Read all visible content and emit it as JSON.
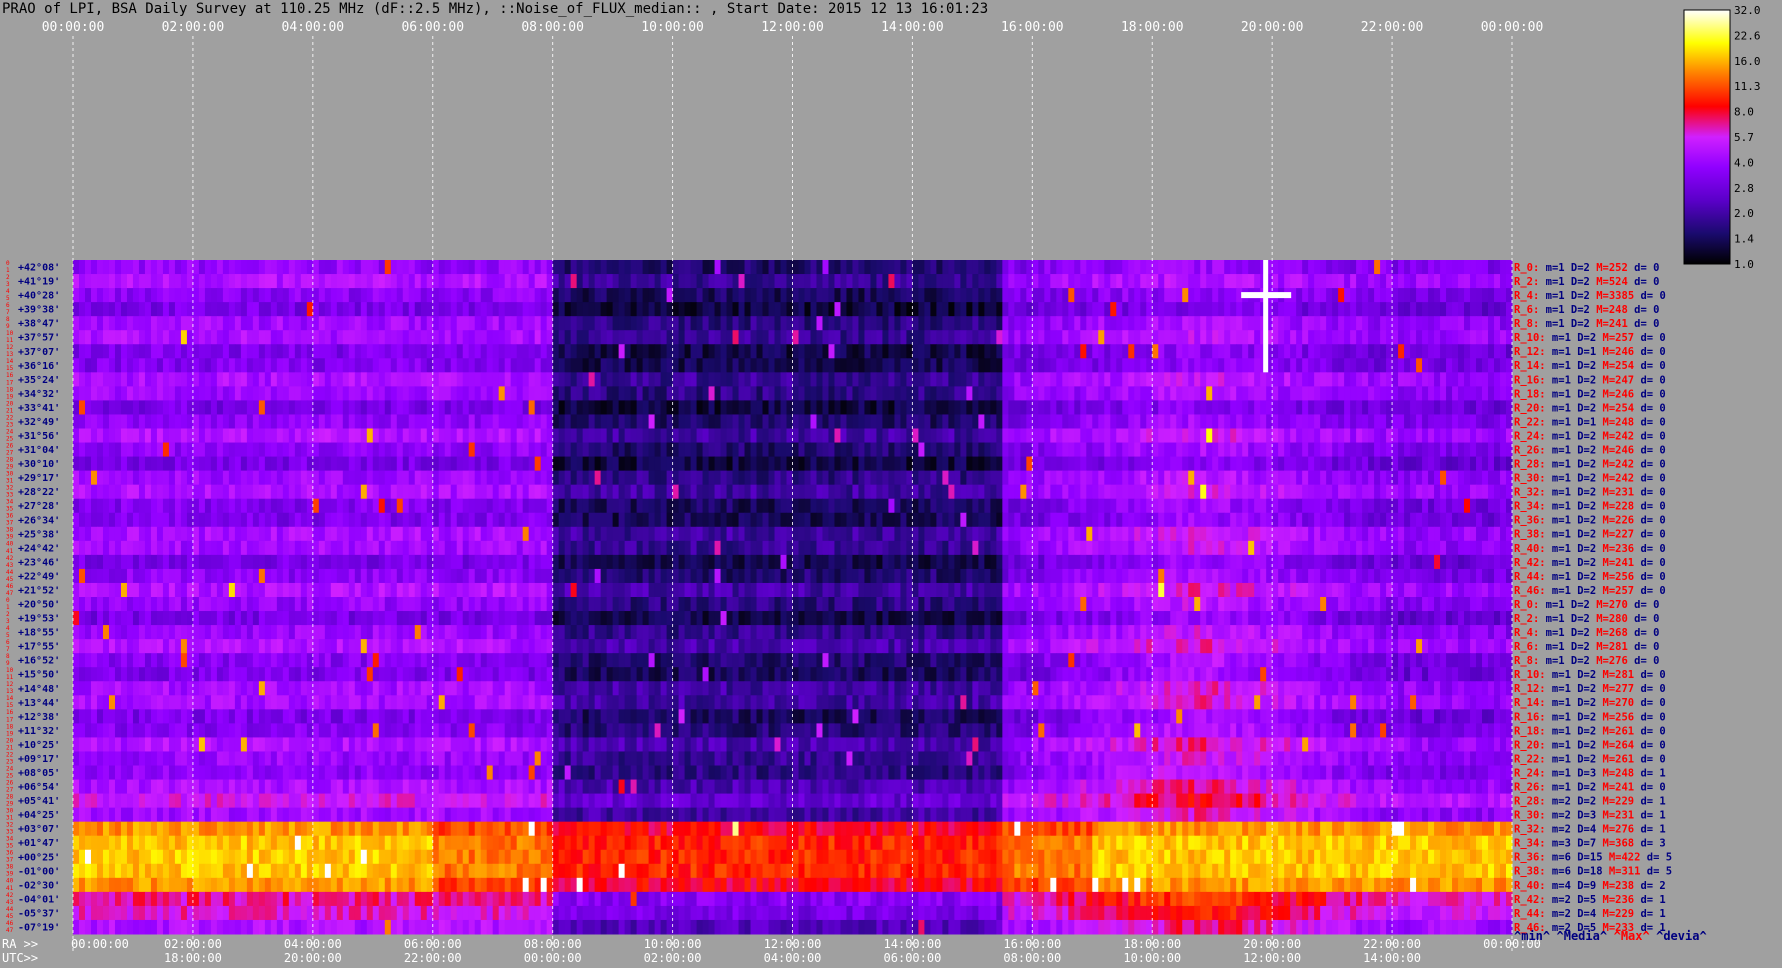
{
  "title": "PRAO of LPI, BSA Daily Survey at 110.25 MHz (dF::2.5 MHz), ::Noise_of_FLUX_median:: , Start Date: 2015 12 13 16:01:23",
  "colors": {
    "background": "#a0a0a0",
    "label_red": "#ff0000",
    "label_navy": "#000080",
    "label_blue": "#0000c0"
  },
  "chart_data": {
    "type": "heatmap",
    "title": "PRAO of LPI, BSA Daily Survey at 110.25 MHz (dF::2.5 MHz), ::Noise_of_FLUX_median:: , Start Date: 2015 12 13 16:01:23",
    "x_ra_ticks": [
      "00:00:00",
      "02:00:00",
      "04:00:00",
      "06:00:00",
      "08:00:00",
      "10:00:00",
      "12:00:00",
      "14:00:00",
      "16:00:00",
      "18:00:00",
      "20:00:00",
      "22:00:00",
      "00:00:00"
    ],
    "x_utc_ticks": [
      "18:00:00",
      "20:00:00",
      "22:00:00",
      "00:00:00",
      "02:00:00",
      "04:00:00",
      "06:00:00",
      "08:00:00",
      "10:00:00",
      "12:00:00",
      "14:00:00"
    ],
    "x_axis_prefix_ra": "RA >>",
    "x_axis_prefix_utc": "UTC>>",
    "bottom_first_tick": "00:00:00",
    "y_declinations": [
      "+42°08'",
      "+41°19'",
      "+40°28'",
      "+39°38'",
      "+38°47'",
      "+37°57'",
      "+37°07'",
      "+36°16'",
      "+35°24'",
      "+34°32'",
      "+33°41'",
      "+32°49'",
      "+31°56'",
      "+31°04'",
      "+30°10'",
      "+29°17'",
      "+28°22'",
      "+27°28'",
      "+26°34'",
      "+25°38'",
      "+24°42'",
      "+23°46'",
      "+22°49'",
      "+21°52'",
      "+20°50'",
      "+19°53'",
      "+18°55'",
      "+17°55'",
      "+16°52'",
      "+15°50'",
      "+14°48'",
      "+13°44'",
      "+12°38'",
      "+11°32'",
      "+10°25'",
      "+09°17'",
      "+08°05'",
      "+06°54'",
      "+05°41'",
      "+04°25'",
      "+03°07'",
      "+01°47'",
      "+00°25'",
      "-01°00'",
      "-02°30'",
      "-04°01'",
      "-05°37'",
      "-07°19'"
    ],
    "row_numbers": [
      "0",
      "1",
      "2",
      "3",
      "4",
      "5",
      "6",
      "7",
      "8",
      "9",
      "10",
      "11",
      "12",
      "13",
      "14",
      "15",
      "16",
      "17",
      "18",
      "19",
      "20",
      "21",
      "22",
      "23",
      "24",
      "25",
      "26",
      "27",
      "28",
      "29",
      "30",
      "31",
      "32",
      "33",
      "34",
      "35",
      "36",
      "37",
      "38",
      "39",
      "40",
      "41",
      "42",
      "43",
      "44",
      "45",
      "46",
      "47",
      "0",
      "1",
      "2",
      "3",
      "4",
      "5",
      "6",
      "7",
      "8",
      "9",
      "10",
      "11",
      "12",
      "13",
      "14",
      "15",
      "16",
      "17",
      "18",
      "19",
      "20",
      "21",
      "22",
      "23",
      "24",
      "25",
      "26",
      "27",
      "28",
      "29",
      "30",
      "31",
      "32",
      "33",
      "34",
      "35",
      "36",
      "37",
      "38",
      "39",
      "40",
      "41",
      "42",
      "43",
      "44",
      "45",
      "46",
      "47"
    ],
    "row_stats": [
      {
        "r": "R_0:",
        "m": "m=1",
        "d": "D=2",
        "M": "M=252",
        "dv": "d= 0"
      },
      {
        "r": "R_2:",
        "m": "m=1",
        "d": "D=2",
        "M": "M=524",
        "dv": "d= 0"
      },
      {
        "r": "R_4:",
        "m": "m=1",
        "d": "D=2",
        "M": "M=3385",
        "dv": "d= 0"
      },
      {
        "r": "R_6:",
        "m": "m=1",
        "d": "D=2",
        "M": "M=248",
        "dv": "d= 0"
      },
      {
        "r": "R_8:",
        "m": "m=1",
        "d": "D=2",
        "M": "M=241",
        "dv": "d= 0"
      },
      {
        "r": "R_10:",
        "m": "m=1",
        "d": "D=2",
        "M": "M=257",
        "dv": "d= 0"
      },
      {
        "r": "R_12:",
        "m": "m=1",
        "d": "D=1",
        "M": "M=246",
        "dv": "d= 0"
      },
      {
        "r": "R_14:",
        "m": "m=1",
        "d": "D=2",
        "M": "M=254",
        "dv": "d= 0"
      },
      {
        "r": "R_16:",
        "m": "m=1",
        "d": "D=2",
        "M": "M=247",
        "dv": "d= 0"
      },
      {
        "r": "R_18:",
        "m": "m=1",
        "d": "D=2",
        "M": "M=246",
        "dv": "d= 0"
      },
      {
        "r": "R_20:",
        "m": "m=1",
        "d": "D=2",
        "M": "M=254",
        "dv": "d= 0"
      },
      {
        "r": "R_22:",
        "m": "m=1",
        "d": "D=1",
        "M": "M=248",
        "dv": "d= 0"
      },
      {
        "r": "R_24:",
        "m": "m=1",
        "d": "D=2",
        "M": "M=242",
        "dv": "d= 0"
      },
      {
        "r": "R_26:",
        "m": "m=1",
        "d": "D=2",
        "M": "M=246",
        "dv": "d= 0"
      },
      {
        "r": "R_28:",
        "m": "m=1",
        "d": "D=2",
        "M": "M=242",
        "dv": "d= 0"
      },
      {
        "r": "R_30:",
        "m": "m=1",
        "d": "D=2",
        "M": "M=242",
        "dv": "d= 0"
      },
      {
        "r": "R_32:",
        "m": "m=1",
        "d": "D=2",
        "M": "M=231",
        "dv": "d= 0"
      },
      {
        "r": "R_34:",
        "m": "m=1",
        "d": "D=2",
        "M": "M=228",
        "dv": "d= 0"
      },
      {
        "r": "R_36:",
        "m": "m=1",
        "d": "D=2",
        "M": "M=226",
        "dv": "d= 0"
      },
      {
        "r": "R_38:",
        "m": "m=1",
        "d": "D=2",
        "M": "M=227",
        "dv": "d= 0"
      },
      {
        "r": "R_40:",
        "m": "m=1",
        "d": "D=2",
        "M": "M=236",
        "dv": "d= 0"
      },
      {
        "r": "R_42:",
        "m": "m=1",
        "d": "D=2",
        "M": "M=241",
        "dv": "d= 0"
      },
      {
        "r": "R_44:",
        "m": "m=1",
        "d": "D=2",
        "M": "M=256",
        "dv": "d= 0"
      },
      {
        "r": "R_46:",
        "m": "m=1",
        "d": "D=2",
        "M": "M=257",
        "dv": "d= 0"
      },
      {
        "r": "R_0:",
        "m": "m=1",
        "d": "D=2",
        "M": "M=270",
        "dv": "d= 0"
      },
      {
        "r": "R_2:",
        "m": "m=1",
        "d": "D=2",
        "M": "M=280",
        "dv": "d= 0"
      },
      {
        "r": "R_4:",
        "m": "m=1",
        "d": "D=2",
        "M": "M=268",
        "dv": "d= 0"
      },
      {
        "r": "R_6:",
        "m": "m=1",
        "d": "D=2",
        "M": "M=281",
        "dv": "d= 0"
      },
      {
        "r": "R_8:",
        "m": "m=1",
        "d": "D=2",
        "M": "M=276",
        "dv": "d= 0"
      },
      {
        "r": "R_10:",
        "m": "m=1",
        "d": "D=2",
        "M": "M=281",
        "dv": "d= 0"
      },
      {
        "r": "R_12:",
        "m": "m=1",
        "d": "D=2",
        "M": "M=277",
        "dv": "d= 0"
      },
      {
        "r": "R_14:",
        "m": "m=1",
        "d": "D=2",
        "M": "M=270",
        "dv": "d= 0"
      },
      {
        "r": "R_16:",
        "m": "m=1",
        "d": "D=2",
        "M": "M=256",
        "dv": "d= 0"
      },
      {
        "r": "R_18:",
        "m": "m=1",
        "d": "D=2",
        "M": "M=261",
        "dv": "d= 0"
      },
      {
        "r": "R_20:",
        "m": "m=1",
        "d": "D=2",
        "M": "M=264",
        "dv": "d= 0"
      },
      {
        "r": "R_22:",
        "m": "m=1",
        "d": "D=2",
        "M": "M=261",
        "dv": "d= 0"
      },
      {
        "r": "R_24:",
        "m": "m=1",
        "d": "D=3",
        "M": "M=248",
        "dv": "d= 1"
      },
      {
        "r": "R_26:",
        "m": "m=1",
        "d": "D=2",
        "M": "M=241",
        "dv": "d= 0"
      },
      {
        "r": "R_28:",
        "m": "m=2",
        "d": "D=2",
        "M": "M=229",
        "dv": "d= 1"
      },
      {
        "r": "R_30:",
        "m": "m=2",
        "d": "D=3",
        "M": "M=231",
        "dv": "d= 1"
      },
      {
        "r": "R_32:",
        "m": "m=2",
        "d": "D=4",
        "M": "M=276",
        "dv": "d= 1"
      },
      {
        "r": "R_34:",
        "m": "m=3",
        "d": "D=7",
        "M": "M=368",
        "dv": "d= 3"
      },
      {
        "r": "R_36:",
        "m": "m=6",
        "d": "D=15",
        "M": "M=422",
        "dv": "d= 5"
      },
      {
        "r": "R_38:",
        "m": "m=6",
        "d": "D=18",
        "M": "M=311",
        "dv": "d= 5"
      },
      {
        "r": "R_40:",
        "m": "m=4",
        "d": "D=9",
        "M": "M=238",
        "dv": "d= 2"
      },
      {
        "r": "R_42:",
        "m": "m=2",
        "d": "D=5",
        "M": "M=236",
        "dv": "d= 1"
      },
      {
        "r": "R_44:",
        "m": "m=2",
        "d": "D=4",
        "M": "M=229",
        "dv": "d= 1"
      },
      {
        "r": "R_46:",
        "m": "m=2",
        "d": "D=5",
        "M": "M=233",
        "dv": "d= 1"
      }
    ],
    "stats_legend": [
      "^min^",
      "^Media^",
      "^Max^",
      "^devia^"
    ],
    "colorbar_ticks": [
      "32.0",
      "22.6",
      "16.0",
      "11.3",
      "8.0",
      "5.7",
      "4.0",
      "2.8",
      "2.0",
      "1.4",
      "1.0"
    ],
    "colorbar_range": [
      1.0,
      32.0
    ],
    "colorbar_scale": "log",
    "colormap": [
      "#000000",
      "#1a0a6e",
      "#5a00c8",
      "#9000ff",
      "#d020ff",
      "#ff0000",
      "#ff8000",
      "#ffff00",
      "#ffffff"
    ],
    "ra_hours_per_row": 24,
    "sun_transit_ra_hours": 20.0,
    "band_structure": {
      "dark_region_ra": [
        8.0,
        15.5
      ],
      "bright_band_declinations": [
        "+01°47'",
        "-01°00'"
      ],
      "transient_source_ra": 19.9,
      "transient_source_dec": "+40°28'"
    }
  }
}
